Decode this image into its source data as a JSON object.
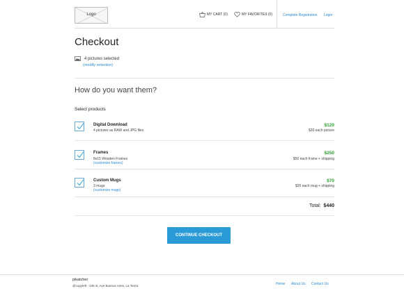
{
  "header": {
    "logo_label": "Logo",
    "cart_label": "MY CART (0)",
    "favorites_label": "MY FAVORITES (0)",
    "complete_registration": "Complete Registration",
    "login": "Login"
  },
  "page": {
    "title": "Checkout",
    "selection_text": "4 pictures selected",
    "modify_selection": "(modify selection)"
  },
  "products_section": {
    "heading": "How do you want them?",
    "subheading": "Select products",
    "items": [
      {
        "name": "Digital Download",
        "description": "4 pictures as RAW and JPG files",
        "link": "",
        "price": "$120",
        "note": "$30 each picture",
        "checked": true
      },
      {
        "name": "Frames",
        "description": "8x15 Wooden Frames",
        "link": "(customize frames)",
        "price": "$250",
        "note": "$50 each frame + shipping",
        "checked": true
      },
      {
        "name": "Custom Mugs",
        "description": "3 mugs",
        "link": "(customize mugs)",
        "price": "$70",
        "note": "$20 each mug + shipping",
        "checked": true
      }
    ],
    "total_label": "Total:",
    "total_value": "$440"
  },
  "actions": {
    "continue_label": "CONTINUE CHECKOUT"
  },
  "footer": {
    "brand": "pikatcher",
    "copyright": "@copyleft - 345 st, Ave Buenos Aires, La Tierra",
    "links": [
      "Home",
      "About Us",
      "Contact Us"
    ]
  },
  "colors": {
    "accent": "#2b9bd7",
    "link": "#2a8bd6",
    "price": "#2e9e2e"
  }
}
